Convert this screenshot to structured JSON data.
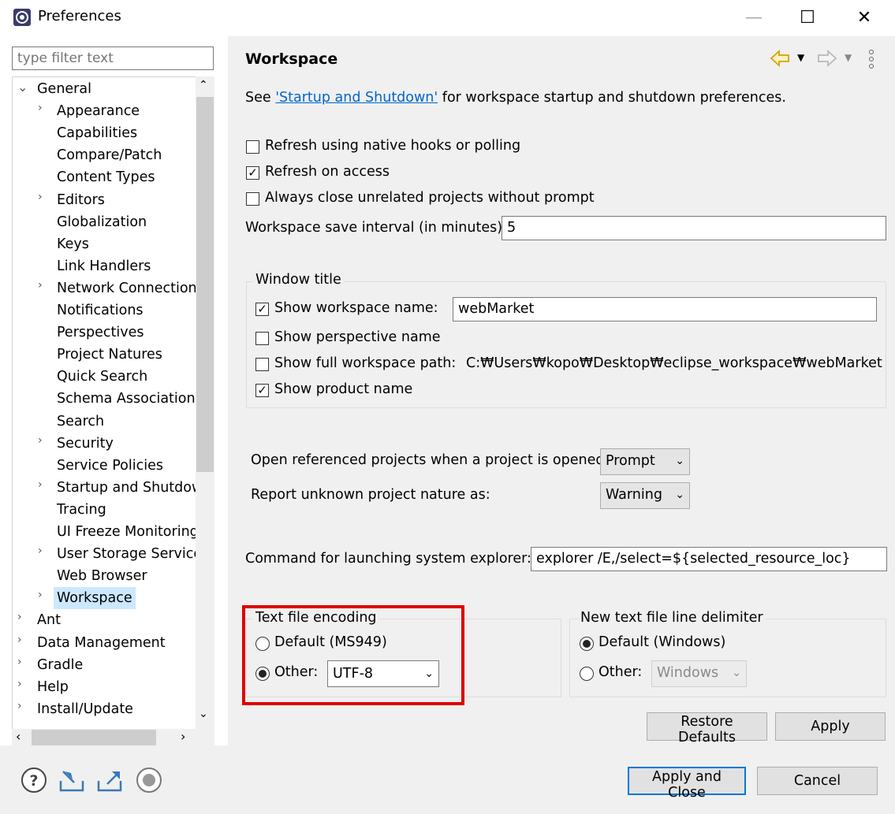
{
  "window": {
    "title": "Preferences",
    "minimize_glyph": "—",
    "maximize_glyph": "☐",
    "close_glyph": "✕"
  },
  "filter": {
    "placeholder": "type filter text"
  },
  "tree": {
    "items": [
      {
        "label": "General",
        "expanded": true,
        "level": 0
      },
      {
        "label": "Appearance",
        "expandable": true,
        "level": 1
      },
      {
        "label": "Capabilities",
        "level": 1
      },
      {
        "label": "Compare/Patch",
        "level": 1
      },
      {
        "label": "Content Types",
        "level": 1
      },
      {
        "label": "Editors",
        "expandable": true,
        "level": 1
      },
      {
        "label": "Globalization",
        "level": 1
      },
      {
        "label": "Keys",
        "level": 1
      },
      {
        "label": "Link Handlers",
        "level": 1
      },
      {
        "label": "Network Connections",
        "expandable": true,
        "level": 1
      },
      {
        "label": "Notifications",
        "level": 1
      },
      {
        "label": "Perspectives",
        "level": 1
      },
      {
        "label": "Project Natures",
        "level": 1
      },
      {
        "label": "Quick Search",
        "level": 1
      },
      {
        "label": "Schema Associations",
        "level": 1
      },
      {
        "label": "Search",
        "level": 1
      },
      {
        "label": "Security",
        "expandable": true,
        "level": 1
      },
      {
        "label": "Service Policies",
        "level": 1
      },
      {
        "label": "Startup and Shutdown",
        "expandable": true,
        "level": 1
      },
      {
        "label": "Tracing",
        "level": 1
      },
      {
        "label": "UI Freeze Monitoring",
        "level": 1
      },
      {
        "label": "User Storage Service",
        "expandable": true,
        "level": 1
      },
      {
        "label": "Web Browser",
        "level": 1
      },
      {
        "label": "Workspace",
        "expandable": true,
        "level": 1,
        "selected": true
      },
      {
        "label": "Ant",
        "expandable": true,
        "level": 0
      },
      {
        "label": "Data Management",
        "expandable": true,
        "level": 0
      },
      {
        "label": "Gradle",
        "expandable": true,
        "level": 0
      },
      {
        "label": "Help",
        "expandable": true,
        "level": 0
      },
      {
        "label": "Install/Update",
        "expandable": true,
        "level": 0
      }
    ]
  },
  "page": {
    "title": "Workspace",
    "intro_prefix": "See ",
    "intro_link": "'Startup and Shutdown'",
    "intro_suffix": " for workspace startup and shutdown preferences.",
    "refresh_native": {
      "label": "Refresh using native hooks or polling",
      "checked": false
    },
    "refresh_access": {
      "label": "Refresh on access",
      "checked": true
    },
    "always_close": {
      "label": "Always close unrelated projects without prompt",
      "checked": false
    },
    "save_interval": {
      "label": "Workspace save interval (in minutes):",
      "value": "5"
    },
    "window_title": {
      "group_label": "Window title",
      "show_workspace_name": {
        "label": "Show workspace name:",
        "checked": true,
        "value": "webMarket"
      },
      "show_perspective_name": {
        "label": "Show perspective name",
        "checked": false
      },
      "show_full_path": {
        "label": "Show full workspace path:",
        "checked": false,
        "value": "C:₩Users₩kopo₩Desktop₩eclipse_workspace₩webMarket"
      },
      "show_product_name": {
        "label": "Show product name",
        "checked": true
      }
    },
    "open_referenced": {
      "label": "Open referenced projects when a project is opened:",
      "value": "Prompt"
    },
    "report_unknown": {
      "label": "Report unknown project nature as:",
      "value": "Warning"
    },
    "explorer_cmd": {
      "label": "Command for launching system explorer:",
      "value": "explorer /E,/select=${selected_resource_loc}"
    },
    "encoding": {
      "group_label": "Text file encoding",
      "default_label": "Default (MS949)",
      "other_label": "Other:",
      "other_value": "UTF-8",
      "selected": "other"
    },
    "line_delimiter": {
      "group_label": "New text file line delimiter",
      "default_label": "Default (Windows)",
      "other_label": "Other:",
      "other_value": "Windows",
      "selected": "default"
    },
    "restore_defaults": "Restore Defaults",
    "apply": "Apply"
  },
  "footer": {
    "apply_close": "Apply and Close",
    "cancel": "Cancel"
  },
  "colors": {
    "highlight_box": "#e00000",
    "link": "#0066cc",
    "selection": "#cce8ff"
  }
}
